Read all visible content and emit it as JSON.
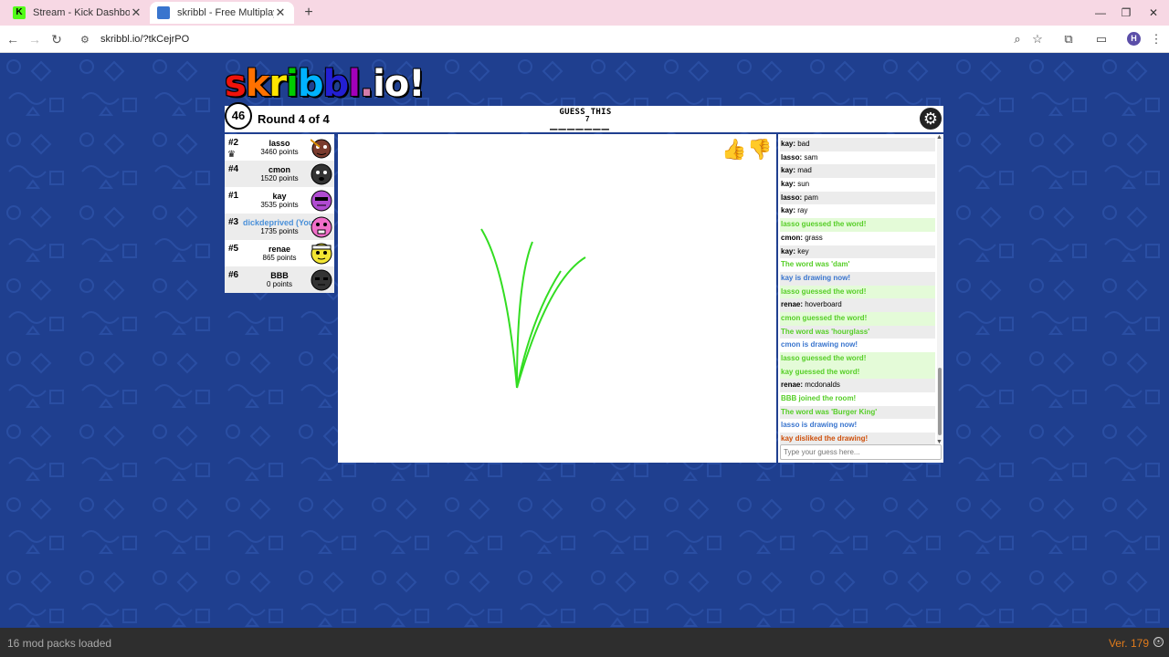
{
  "browser": {
    "tabs": [
      {
        "title": "Stream - Kick Dashboard",
        "favicon_color": "#53fc18",
        "favicon_letter": "K"
      },
      {
        "title": "skribbl - Free Multiplayer Draw",
        "favicon_color": "#3975ce"
      }
    ],
    "url": "skribbl.io/?tkCejrPO",
    "profile_initial": "H"
  },
  "game": {
    "logo": [
      "s",
      "k",
      "r",
      "i",
      "b",
      "b",
      "l",
      ".",
      "i",
      "o",
      "!"
    ],
    "logo_colors": [
      "#ef130b",
      "#ff7100",
      "#ffe400",
      "#00cc00",
      "#00b2ff",
      "#231fd3",
      "#a300ba",
      "#d37caa",
      "#ffffff",
      "#ffffff",
      "#ffffff"
    ],
    "timer": "46",
    "round": "Round 4 of 4",
    "guess_label": "GUESS THIS",
    "hint": "_______",
    "word_length": "7"
  },
  "players": [
    {
      "rank": "#2",
      "name": "lasso",
      "points": "3460 points",
      "face": "#7a3b2e",
      "hat": true,
      "me": false,
      "drawing": true
    },
    {
      "rank": "#4",
      "name": "cmon",
      "points": "1520 points",
      "face": "#333333",
      "me": false
    },
    {
      "rank": "#1",
      "name": "kay",
      "points": "3535 points",
      "face": "#b04bd1",
      "me": false
    },
    {
      "rank": "#3",
      "name": "dickdeprived (You)",
      "points": "1735 points",
      "face": "#f06ec9",
      "me": true
    },
    {
      "rank": "#5",
      "name": "renae",
      "points": "865 points",
      "face": "#f2e533",
      "me": false
    },
    {
      "rank": "#6",
      "name": "BBB",
      "points": "0 points",
      "face": "#333333",
      "me": false
    }
  ],
  "chat": [
    {
      "user": "kay:",
      "text": "bad",
      "type": "normal"
    },
    {
      "user": "lasso:",
      "text": "sam",
      "type": "normal"
    },
    {
      "user": "kay:",
      "text": "mad",
      "type": "normal"
    },
    {
      "user": "kay:",
      "text": "sun",
      "type": "normal"
    },
    {
      "user": "lasso:",
      "text": "pam",
      "type": "normal"
    },
    {
      "user": "kay:",
      "text": "ray",
      "type": "normal"
    },
    {
      "user": "",
      "text": "lasso guessed the word!",
      "type": "green"
    },
    {
      "user": "cmon:",
      "text": "grass",
      "type": "normal"
    },
    {
      "user": "kay:",
      "text": "key",
      "type": "normal"
    },
    {
      "user": "",
      "text": "The word was 'dam'",
      "type": "green-plain"
    },
    {
      "user": "",
      "text": "kay is drawing now!",
      "type": "blue"
    },
    {
      "user": "",
      "text": "lasso guessed the word!",
      "type": "green"
    },
    {
      "user": "renae:",
      "text": "hoverboard",
      "type": "normal"
    },
    {
      "user": "",
      "text": "cmon guessed the word!",
      "type": "green"
    },
    {
      "user": "",
      "text": "The word was 'hourglass'",
      "type": "green-plain"
    },
    {
      "user": "",
      "text": "cmon is drawing now!",
      "type": "blue"
    },
    {
      "user": "",
      "text": "lasso guessed the word!",
      "type": "green"
    },
    {
      "user": "",
      "text": "kay guessed the word!",
      "type": "green"
    },
    {
      "user": "renae:",
      "text": "mcdonalds",
      "type": "normal"
    },
    {
      "user": "",
      "text": "BBB joined the room!",
      "type": "green-plain"
    },
    {
      "user": "",
      "text": "The word was 'Burger King'",
      "type": "green-plain"
    },
    {
      "user": "",
      "text": "lasso is drawing now!",
      "type": "blue"
    },
    {
      "user": "",
      "text": "kay disliked the drawing!",
      "type": "red"
    }
  ],
  "chat_input": {
    "placeholder": "Type your guess here..."
  },
  "status": {
    "mods": "16 mod packs loaded",
    "version": "Ver. 179"
  },
  "colors": {
    "background": "#1f3f8f",
    "stroke": "#33dd22",
    "chat_green": "#56ce27",
    "chat_blue": "#3975ce",
    "chat_red": "#ce4f0a"
  }
}
